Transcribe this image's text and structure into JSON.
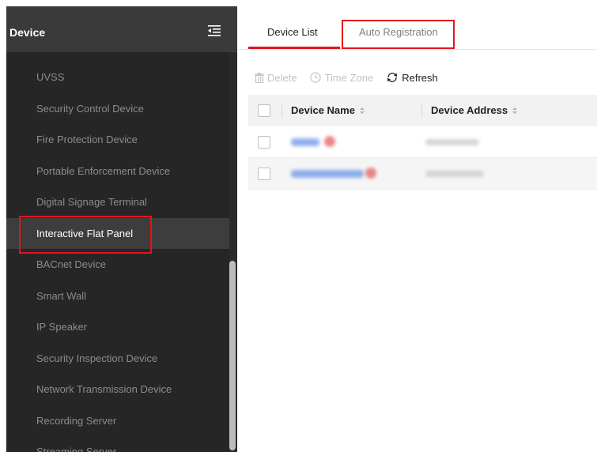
{
  "sidebar": {
    "title": "Device",
    "collapse_icon": "menu-collapse-icon",
    "items": [
      {
        "label": "UVSS"
      },
      {
        "label": "Security Control Device"
      },
      {
        "label": "Fire Protection Device"
      },
      {
        "label": "Portable Enforcement Device"
      },
      {
        "label": "Digital Signage Terminal"
      },
      {
        "label": "Interactive Flat Panel",
        "active": true
      },
      {
        "label": "BACnet Device"
      },
      {
        "label": "Smart Wall"
      },
      {
        "label": "IP Speaker"
      },
      {
        "label": "Security Inspection Device"
      },
      {
        "label": "Network Transmission Device"
      },
      {
        "label": "Recording Server"
      },
      {
        "label": "Streaming Server"
      }
    ]
  },
  "tabs": {
    "device_list": "Device List",
    "auto_registration": "Auto Registration",
    "active": "device_list"
  },
  "toolbar": {
    "delete": {
      "label": "Delete",
      "icon": "trash-icon",
      "enabled": false
    },
    "time_zone": {
      "label": "Time Zone",
      "icon": "clock-icon",
      "enabled": false
    },
    "refresh": {
      "label": "Refresh",
      "icon": "refresh-icon",
      "enabled": true
    }
  },
  "table": {
    "columns": [
      "Device Name",
      "Device Address"
    ],
    "rows": [
      {
        "name": "",
        "address": "",
        "redacted": true
      },
      {
        "name": "",
        "address": "",
        "redacted": true
      }
    ]
  },
  "colors": {
    "sidebar_bg": "#262626",
    "sidebar_header_bg": "#3a3a3a",
    "active_item_bg": "#3d3d3d",
    "accent": "#e4141b",
    "link": "#6a96e8"
  }
}
